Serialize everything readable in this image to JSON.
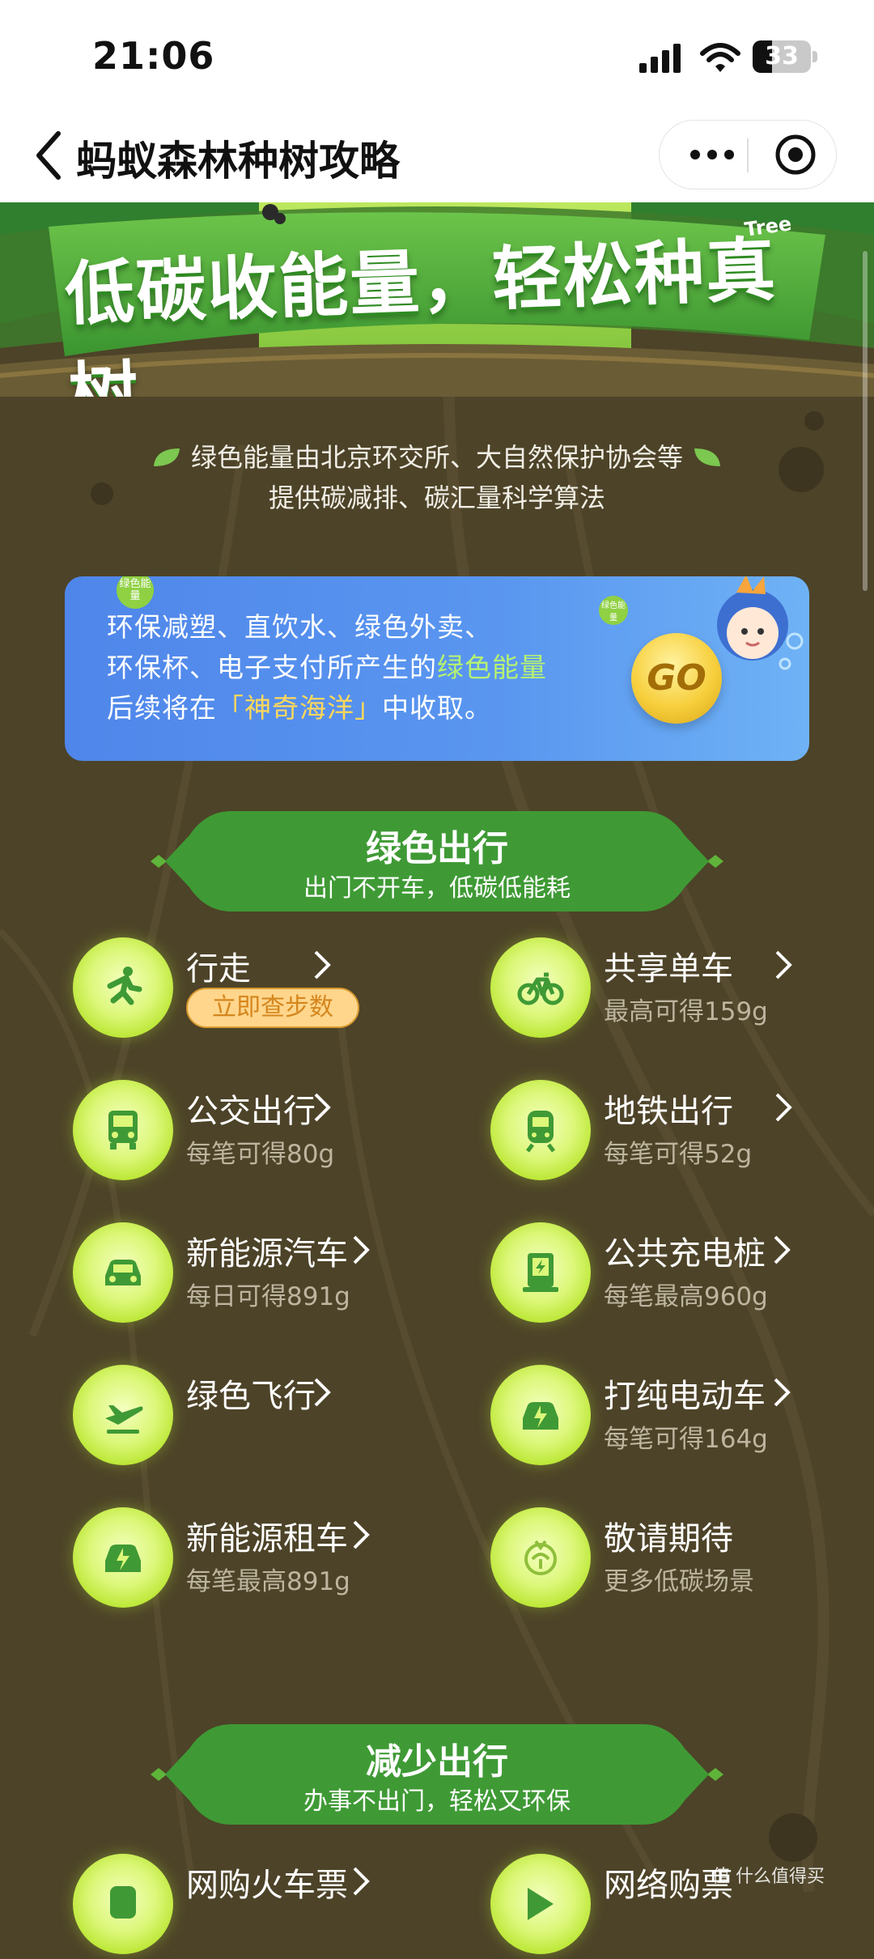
{
  "status": {
    "time": "21:06",
    "battery": "33",
    "battery_level": 0.33
  },
  "nav": {
    "title": "蚂蚁森林种树攻略"
  },
  "banner": {
    "headline": "低碳收能量，轻松种真树。",
    "tag": "Tree"
  },
  "intro": {
    "line1": "绿色能量由北京环交所、大自然保护协会等",
    "line2": "提供碳减排、碳汇量科学算法"
  },
  "ocean": {
    "line1": "环保减塑、直饮水、绿色外卖、",
    "line2_prefix": "环保杯、电子支付所产生的",
    "line2_highlight": "绿色能量",
    "line3_prefix": "后续将在",
    "line3_highlight": "「神奇海洋」",
    "line3_suffix": "中收取。",
    "go_label": "GO",
    "badge_label": "绿色能量"
  },
  "green_travel": {
    "title": "绿色出行",
    "subtitle": "出门不开车，低碳低能耗",
    "items": [
      {
        "title": "行走",
        "action": "立即查步数",
        "icon": "walking-icon"
      },
      {
        "title": "共享单车",
        "sub": "最高可得159g",
        "icon": "bicycle-icon"
      },
      {
        "title": "公交出行",
        "sub": "每笔可得80g",
        "icon": "bus-icon"
      },
      {
        "title": "地铁出行",
        "sub": "每笔可得52g",
        "icon": "subway-icon"
      },
      {
        "title": "新能源汽车",
        "sub": "每日可得891g",
        "icon": "car-icon"
      },
      {
        "title": "公共充电桩",
        "sub": "每笔最高960g",
        "icon": "charging-pile-icon"
      },
      {
        "title": "绿色飞行",
        "sub": "",
        "icon": "airplane-icon"
      },
      {
        "title": "打纯电动车",
        "sub": "每笔可得164g",
        "icon": "electric-taxi-icon"
      },
      {
        "title": "新能源租车",
        "sub": "每笔最高891g",
        "icon": "rental-car-icon"
      },
      {
        "title": "敬请期待",
        "sub": "更多低碳场景",
        "icon": "coming-soon-icon"
      }
    ]
  },
  "less_travel": {
    "title": "减少出行",
    "subtitle": "办事不出门，轻松又环保",
    "items": [
      {
        "title": "网购火车票",
        "icon": "train-ticket-icon"
      },
      {
        "title": "网络购票",
        "icon": "online-ticket-icon"
      }
    ]
  },
  "watermark": "值 什么值得买",
  "colors": {
    "background": "#4d4328",
    "ribbon": "#3f9a35",
    "orb": "#c8ee4a",
    "ocean_card": "#5a97f0",
    "step_button": "#ffd68c"
  }
}
